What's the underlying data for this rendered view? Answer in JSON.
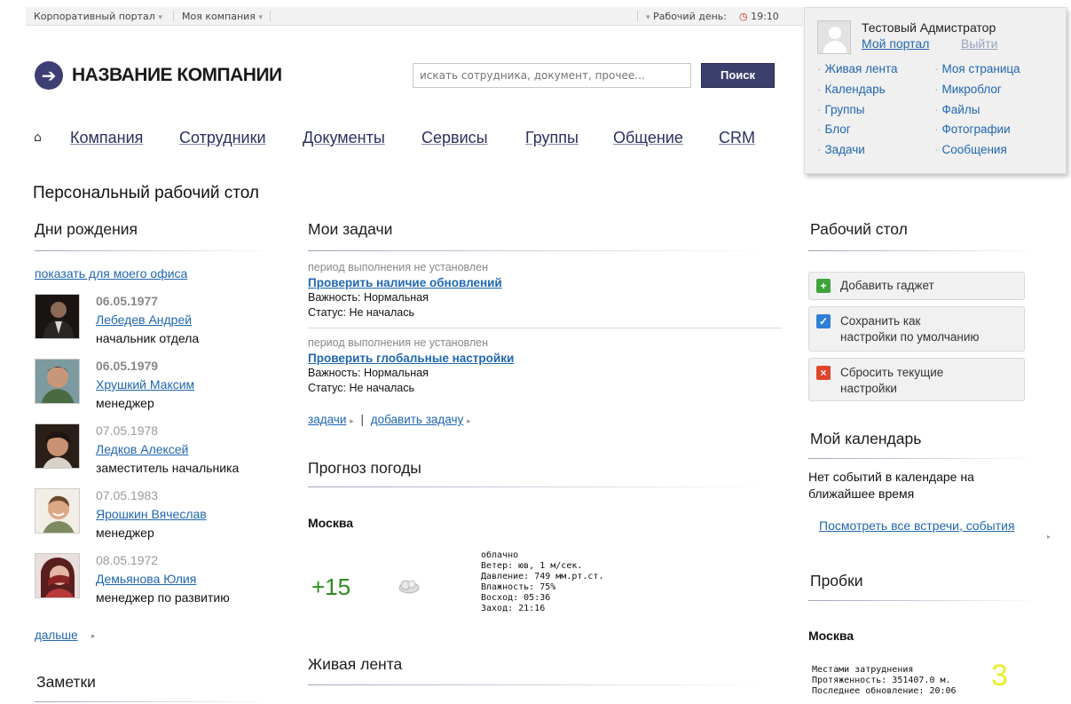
{
  "topbar": {
    "portal": "Корпоративный портал",
    "company": "Моя компания",
    "workday_label": "Рабочий день:",
    "time": "19:10"
  },
  "header": {
    "company_name": "НАЗВАНИЕ КОМПАНИИ",
    "search_placeholder": "искать сотрудника, документ, прочее...",
    "search_button": "Поиск"
  },
  "nav": {
    "items": [
      "Компания",
      "Сотрудники",
      "Документы",
      "Сервисы",
      "Группы",
      "Общение",
      "CRM"
    ]
  },
  "user_panel": {
    "name": "Тестовый Адмистратор",
    "my_portal": "Мой портал",
    "logout": "Выйти",
    "links_left": [
      "Живая лента",
      "Календарь",
      "Группы",
      "Блог",
      "Задачи"
    ],
    "links_right": [
      "Моя страница",
      "Микроблог",
      "Файлы",
      "Фотографии",
      "Сообщения"
    ]
  },
  "page_title": "Персональный рабочий стол",
  "birthdays": {
    "heading": "Дни рождения",
    "show_office": "показать для моего офиса",
    "people": [
      {
        "date": "06.05.1977",
        "name": "Лебедев Андрей",
        "position": "начальник отдела"
      },
      {
        "date": "06.05.1979",
        "name": "Хрушкий Максим",
        "position": "менеджер"
      },
      {
        "date": "07.05.1978",
        "name": "Ледков Алексей",
        "position": "заместитель начальника"
      },
      {
        "date": "07.05.1983",
        "name": "Ярошкин Вячеслав",
        "position": "менеджер"
      },
      {
        "date": "08.05.1972",
        "name": "Демьянова Юлия",
        "position": "менеджер по развитию"
      }
    ],
    "more": "дальше"
  },
  "notes": {
    "heading": "Заметки"
  },
  "tasks": {
    "heading": "Мои задачи",
    "items": [
      {
        "period": "период выполнения не установлен",
        "title": "Проверить наличие обновлений",
        "importance": "Важность: Нормальная",
        "status": "Статус: Не началась"
      },
      {
        "period": "период выполнения не установлен",
        "title": "Проверить глобальные настройки",
        "importance": "Важность: Нормальная",
        "status": "Статус: Не началась"
      }
    ],
    "link_tasks": "задачи",
    "link_add": "добавить задачу"
  },
  "weather": {
    "heading": "Прогноз погоды",
    "city": "Москва",
    "temp": "+15",
    "icon": "cloud-icon",
    "details": [
      "облачно",
      "Ветер: юв, 1 м/сек.",
      "Давление: 749 мм.рт.ст.",
      "Влажность: 75%",
      "Восход: 05:36",
      "Заход: 21:16"
    ]
  },
  "feed": {
    "heading": "Живая лента"
  },
  "desktop": {
    "heading": "Рабочий стол",
    "add_gadget": "Добавить гаджет",
    "save_default_1": "Сохранить как",
    "save_default_2": "настройки по умолчанию",
    "reset_1": "Сбросить текущие",
    "reset_2": "настройки"
  },
  "calendar": {
    "heading": "Мой календарь",
    "empty": "Нет событий в календаре на ближайшее время",
    "view_all": "Посмотреть все встречи, события"
  },
  "traffic": {
    "heading": "Пробки",
    "city": "Москва",
    "details": [
      "Местами затруднения",
      "Протяженность: 351407.0 м.",
      "Последнее обновление: 20:06"
    ],
    "level": "3"
  },
  "colors": {
    "accent": "#2067b0",
    "brand": "#3a3f6b",
    "temp": "#2e8b22",
    "traffic_level": "#e6ee2a"
  }
}
